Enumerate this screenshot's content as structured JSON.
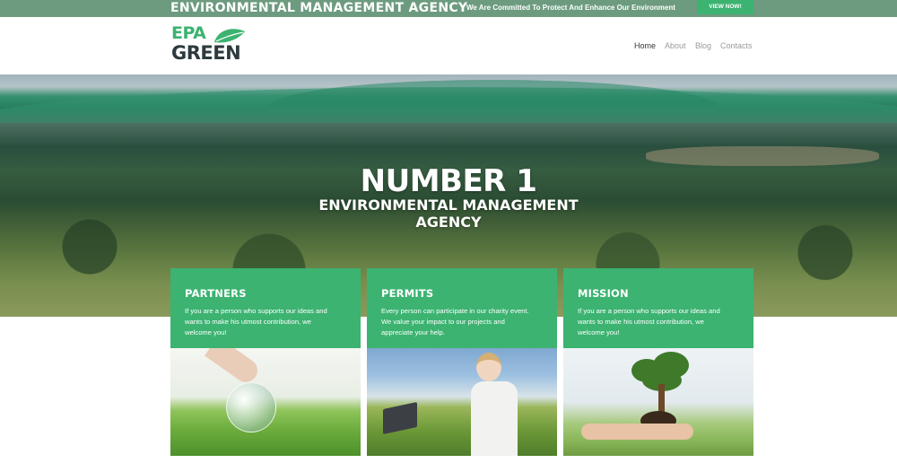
{
  "topbar": {
    "agency": "ENVIRONMENTAL MANAGEMENT AGENCY",
    "tagline": "We Are Committed To Protect And Enhance Our Environment",
    "cta": "VIEW NOW!"
  },
  "logo": {
    "line1": "EPA",
    "line2": "GREEN"
  },
  "nav": {
    "items": [
      {
        "label": "Home",
        "active": true
      },
      {
        "label": "About",
        "active": false
      },
      {
        "label": "Blog",
        "active": false
      },
      {
        "label": "Contacts",
        "active": false
      }
    ]
  },
  "hero": {
    "heading": "NUMBER 1",
    "subheading_line1": "ENVIRONMENTAL MANAGEMENT",
    "subheading_line2": "AGENCY"
  },
  "cards": [
    {
      "title": "PARTNERS",
      "desc_line1": "If you are a person who supports our ideas and",
      "desc_line2": "wants to make his utmost contribution, we",
      "desc_line3": "welcome you!",
      "image": "hand-with-glass-globe-on-grass"
    },
    {
      "title": "PERMITS",
      "desc_line1": "Every person can participate in our charity event.",
      "desc_line2": "We value your impact to our projects and",
      "desc_line3": "appreciate your help.",
      "image": "woman-with-laptop-in-field"
    },
    {
      "title": "MISSION",
      "desc_line1": "If you are a person who supports our ideas and",
      "desc_line2": "wants to make his utmost contribution, we",
      "desc_line3": "welcome you!",
      "image": "hand-holding-sapling"
    }
  ],
  "colors": {
    "brand_green": "#3cb371",
    "topbar": "#6d9b7f",
    "logo_dark": "#2d3a3f",
    "nav_active": "#333333",
    "nav_inactive": "#9a9a9a"
  }
}
